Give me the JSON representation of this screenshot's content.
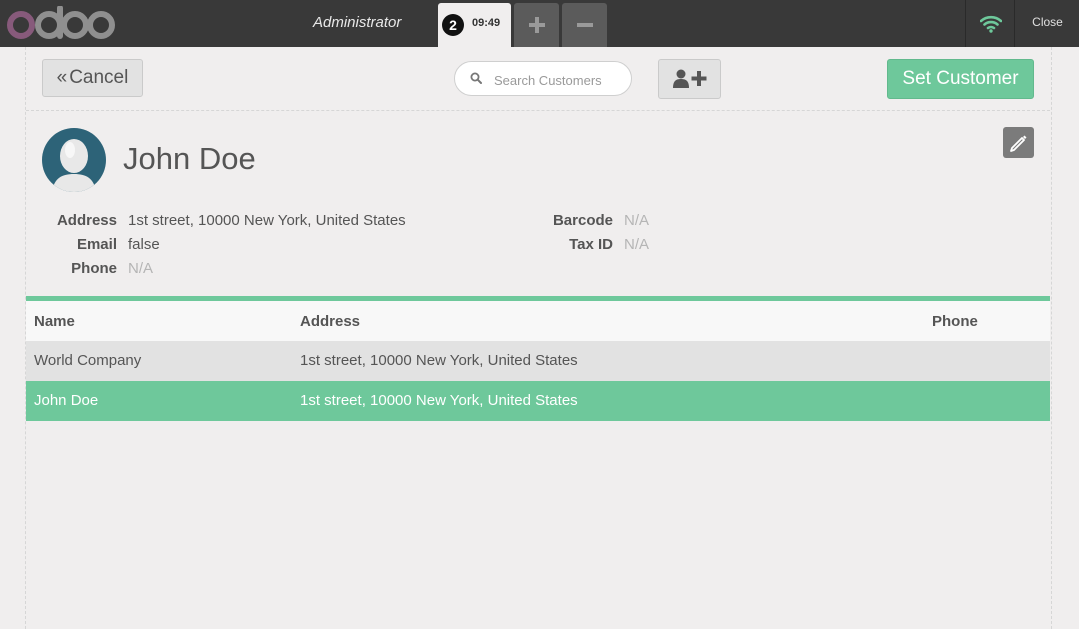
{
  "header": {
    "logo_text": "odoo",
    "cashier": "Administrator",
    "order": {
      "number": "2",
      "time": "09:49"
    },
    "add_order_icon": "plus-icon",
    "remove_order_icon": "minus-icon",
    "network_icon": "wifi-icon",
    "close_label": "Close"
  },
  "toolbar": {
    "cancel_label": "Cancel",
    "search_placeholder": "Search Customers",
    "new_customer_icon": "add-user-icon",
    "set_customer_label": "Set Customer"
  },
  "customer": {
    "name": "John Doe",
    "address_label": "Address",
    "address": "1st street, 10000 New York, United States",
    "email_label": "Email",
    "email": "false",
    "phone_label": "Phone",
    "phone": "N/A",
    "barcode_label": "Barcode",
    "barcode": "N/A",
    "tax_label": "Tax ID",
    "tax": "N/A"
  },
  "table": {
    "columns": [
      "Name",
      "Address",
      "Phone"
    ],
    "rows": [
      {
        "name": "World Company",
        "address": "1st street, 10000 New York, United States",
        "phone": ""
      },
      {
        "name": "John Doe",
        "address": "1st street, 10000 New York, United States",
        "phone": "",
        "selected": true
      }
    ]
  },
  "colors": {
    "accent": "#6ec89b",
    "topbar": "#393939",
    "logo": "#875a7b",
    "wifi": "#6ec89b"
  }
}
